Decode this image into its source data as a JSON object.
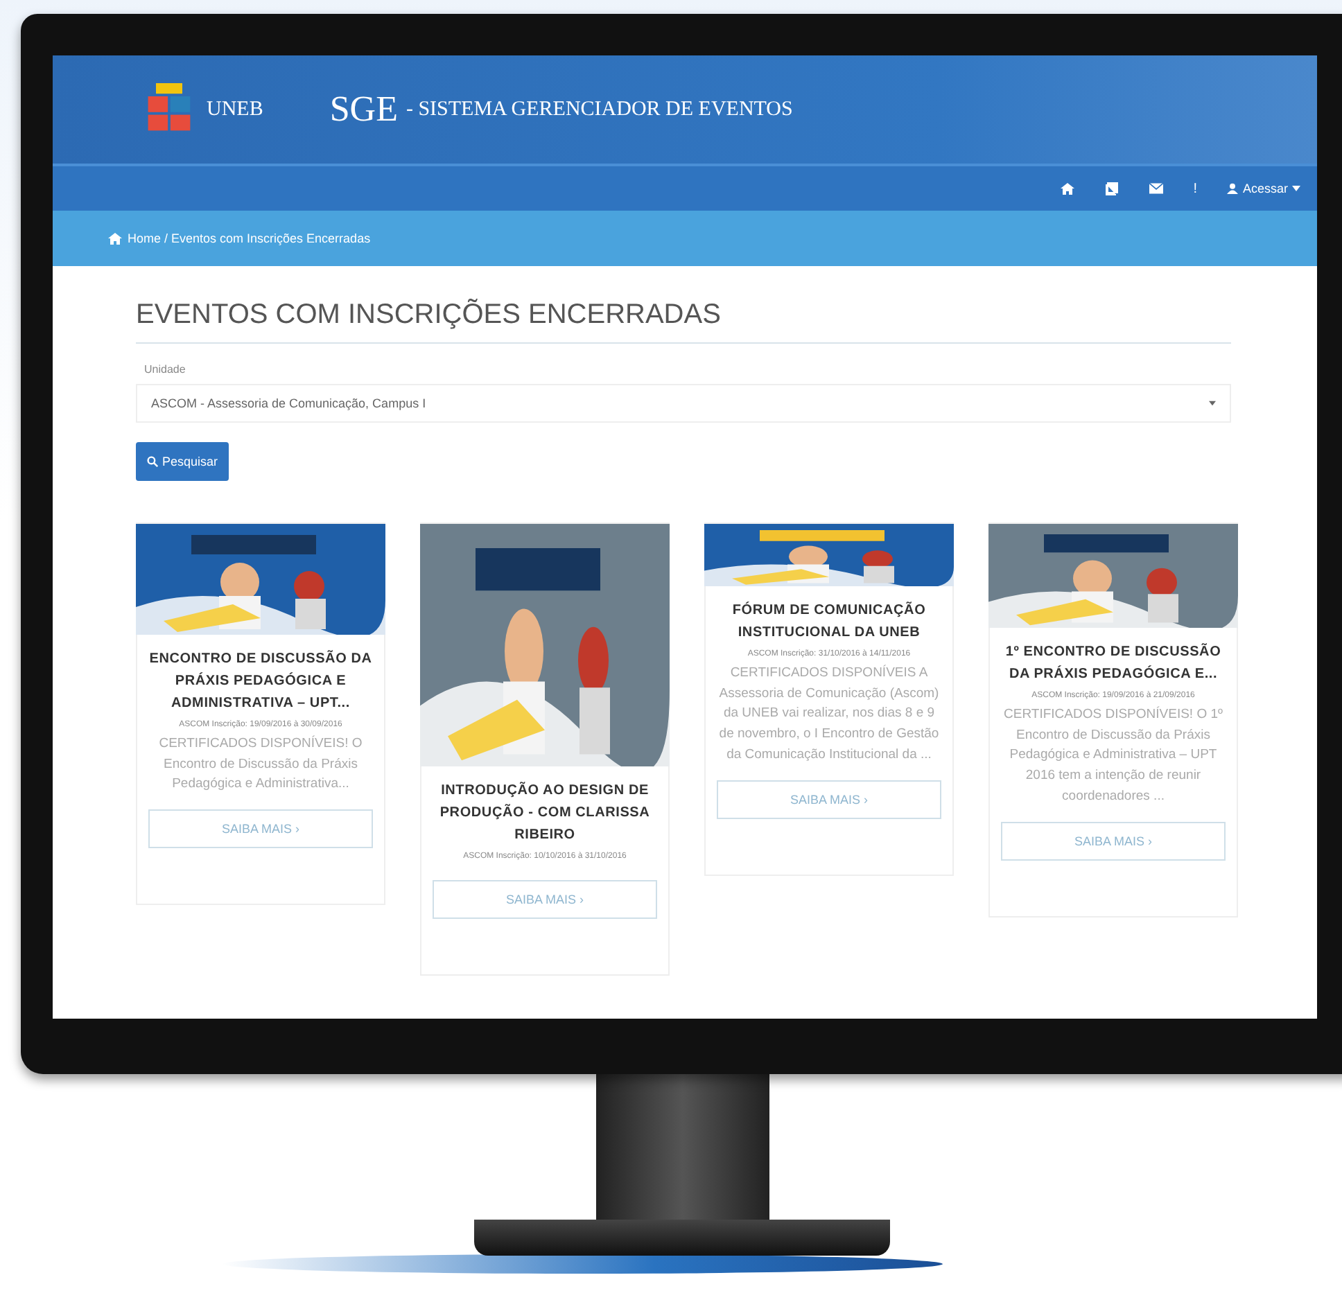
{
  "header": {
    "logo_text": "UNEB",
    "title": "SGE",
    "subtitle": "- SISTEMA GERENCIADOR DE EVENTOS"
  },
  "nav": {
    "items": [
      {
        "kind": "home"
      },
      {
        "kind": "book"
      },
      {
        "kind": "mail"
      },
      {
        "kind": "text",
        "label": "!"
      }
    ],
    "account": "Acessar"
  },
  "breadcrumb": "Home / Eventos com Inscrições Encerradas",
  "page_title": "EVENTOS COM INSCRIÇÕES ENCERRADAS",
  "filter": {
    "label": "Unidade",
    "value": "ASCOM - Assessoria de Comunicação, Campus I",
    "button": "Pesquisar"
  },
  "events": [
    {
      "title": "ENCONTRO DE DISCUSSÃO DA PRÁXIS PEDAGÓGICA E ADMINISTRATIVA – UPT...",
      "meta": "ASCOM Inscrição: 19/09/2016 à 30/09/2016",
      "description": "CERTIFICADOS DISPONÍVEIS! O Encontro de Discussão da Práxis Pedagógica e Administrativa...",
      "button": "SAIBA MAIS ›"
    },
    {
      "title": "INTRODUÇÃO AO DESIGN DE PRODUÇÃO - COM CLARISSA RIBEIRO",
      "meta": "ASCOM Inscrição: 10/10/2016 à 31/10/2016",
      "button": "SAIBA MAIS ›"
    },
    {
      "title": "FÓRUM DE COMUNICAÇÃO INSTITUCIONAL DA UNEB",
      "meta": "ASCOM Inscrição: 31/10/2016 à 14/11/2016",
      "description": "CERTIFICADOS DISPONÍVEIS A Assessoria de Comunicação (Ascom) da UNEB vai realizar, nos dias 8 e 9 de novembro, o I Encontro de Gestão da Comunicação Institucional da ...",
      "button": "SAIBA MAIS ›"
    },
    {
      "title": "1º ENCONTRO DE DISCUSSÃO DA PRÁXIS PEDAGÓGICA E...",
      "meta": "ASCOM Inscrição: 19/09/2016 à 21/09/2016",
      "description": "CERTIFICADOS DISPONÍVEIS! O 1º Encontro de Discussão da Práxis Pedagógica e Administrativa – UPT 2016 tem a intenção de reunir coordenadores ...",
      "button": "SAIBA MAIS ›"
    }
  ]
}
